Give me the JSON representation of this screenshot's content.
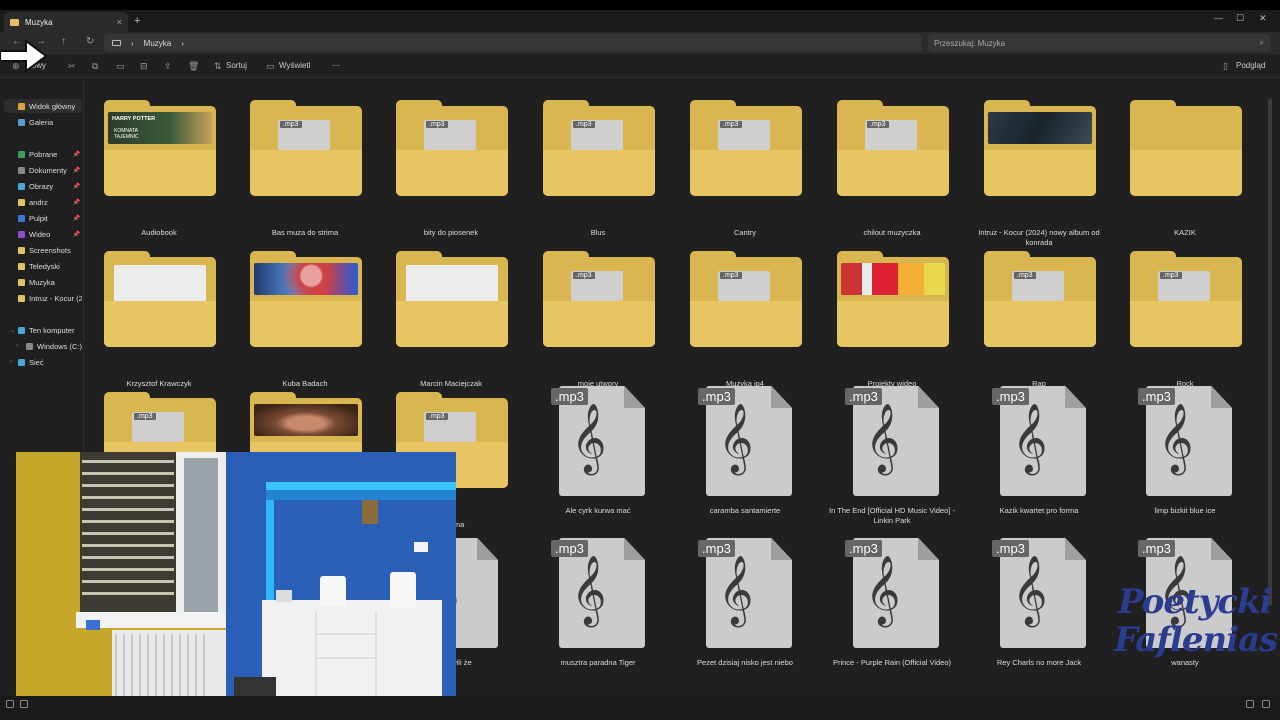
{
  "window": {
    "tab_title": "Muzyka",
    "tab_close": "×",
    "new_tab": "+",
    "minimize": "—",
    "maximize": "☐",
    "close": "✕"
  },
  "nav": {
    "back": "←",
    "forward": "→",
    "up": "↑",
    "refresh": "↻",
    "breadcrumb": [
      "Muzyka"
    ],
    "search_placeholder": "Przeszukaj: Muzyka"
  },
  "toolbar": {
    "new_label": "Nowy",
    "sort_label": "Sortuj",
    "view_label": "Wyświetl",
    "more_label": "···",
    "preview_label": "Podgląd"
  },
  "sidebar": {
    "items": [
      {
        "label": "Widok główny",
        "color": "#d9a441",
        "selected": true
      },
      {
        "label": "Galeria",
        "color": "#5b9bd5"
      },
      {
        "label": "Pobrane",
        "color": "#3aa15a",
        "pinned": true
      },
      {
        "label": "Dokumenty",
        "color": "#8a8a8a",
        "pinned": true
      },
      {
        "label": "Obrazy",
        "color": "#4aa3df",
        "pinned": true
      },
      {
        "label": "andrz",
        "color": "#e5c25f",
        "pinned": true
      },
      {
        "label": "Pulpit",
        "color": "#3b78d8",
        "pinned": true
      },
      {
        "label": "Wideo",
        "color": "#8a4fd1",
        "pinned": true
      },
      {
        "label": "Screenshots",
        "color": "#e5c25f"
      },
      {
        "label": "Teledyski",
        "color": "#e5c25f"
      },
      {
        "label": "Muzyka",
        "color": "#e5c25f"
      },
      {
        "label": "Intruz - Kocur (2",
        "color": "#e5c25f"
      }
    ],
    "tree": [
      {
        "label": "Ten komputer",
        "color": "#4aa3df"
      },
      {
        "label": "Windows (C:)",
        "color": "#8a8a8a"
      },
      {
        "label": "Sieć",
        "color": "#4aa3df"
      }
    ]
  },
  "items": [
    {
      "label": "Audiobook",
      "kind": "folder",
      "thumb": "harry-potter"
    },
    {
      "label": "Bas muza do strima",
      "kind": "folder",
      "thumb": "mp3"
    },
    {
      "label": "bity do piosenek",
      "kind": "folder",
      "thumb": "mp3"
    },
    {
      "label": "Blus",
      "kind": "folder",
      "thumb": "mp3"
    },
    {
      "label": "Cantry",
      "kind": "folder",
      "thumb": "mp3"
    },
    {
      "label": "chilout muzyczka",
      "kind": "folder",
      "thumb": "mp3"
    },
    {
      "label": "Intruz - Kocur (2024) nowy album od konrada",
      "kind": "folder",
      "thumb": "dark"
    },
    {
      "label": "KAZIK",
      "kind": "folder",
      "thumb": "none"
    },
    {
      "label": "Krzysztof Krawczyk",
      "kind": "folder",
      "thumb": "paper"
    },
    {
      "label": "Kuba Badach",
      "kind": "folder",
      "thumb": "photo"
    },
    {
      "label": "Marcin Maciejczak",
      "kind": "folder",
      "thumb": "paper"
    },
    {
      "label": "moje utwory",
      "kind": "folder",
      "thumb": "mp3"
    },
    {
      "label": "Muzyka ip4",
      "kind": "folder",
      "thumb": "mp3"
    },
    {
      "label": "Projekty wideo",
      "kind": "folder",
      "thumb": "color"
    },
    {
      "label": "Rap",
      "kind": "folder",
      "thumb": "mp3"
    },
    {
      "label": "Rock",
      "kind": "folder",
      "thumb": "mp3"
    },
    {
      "label": "",
      "kind": "folder",
      "thumb": "mp3"
    },
    {
      "label": "",
      "kind": "folder",
      "thumb": "video"
    },
    {
      "label": "a strima",
      "kind": "folder",
      "thumb": "mp3"
    },
    {
      "label": "Ale cyrk kurwa mać",
      "kind": "mp3"
    },
    {
      "label": "caramba santamierte",
      "kind": "mp3"
    },
    {
      "label": "In The End [Official HD Music Video] - Linkin Park",
      "kind": "mp3"
    },
    {
      "label": "Kazik kwartet pro forma",
      "kind": "mp3"
    },
    {
      "label": "limp bizkit  blue ice",
      "kind": "mp3"
    },
    {
      "label": "",
      "kind": "hidden"
    },
    {
      "label": "",
      "kind": "hidden"
    },
    {
      "label": "na mówili że",
      "kind": "mp3"
    },
    {
      "label": "musztra paradna Tiger",
      "kind": "mp3"
    },
    {
      "label": "Pezet dzisiaj nisko jest niebo",
      "kind": "mp3"
    },
    {
      "label": "Prince - Purple Rain (Official Video)",
      "kind": "mp3"
    },
    {
      "label": "Rey Charls no more Jack",
      "kind": "mp3"
    },
    {
      "label": "wanasty",
      "kind": "mp3"
    }
  ],
  "mp3_badge": ".mp3",
  "clef_glyph": "𝄞",
  "thumb_text": {
    "hp_line1": "HARRY POTTER",
    "hp_line2": "KOMNATA TAJEMNIC"
  },
  "logo": {
    "line1": "Poetycki",
    "line2": "Faflenias"
  }
}
